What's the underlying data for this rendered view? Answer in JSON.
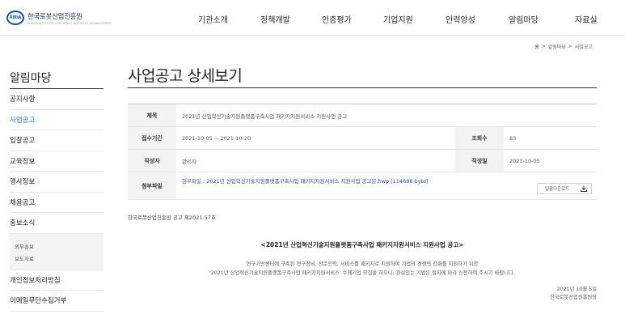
{
  "header": {
    "logo_mark": "KIRIA",
    "logo_name": "한국로봇산업진흥원",
    "logo_sub": "KOREA INSTITUTE FOR ROBOT INDUSTRY ADVANCEMENT",
    "nav": [
      "기관소개",
      "정책개발",
      "인증평가",
      "기업지원",
      "인력양성",
      "알림마당",
      "자료실"
    ]
  },
  "breadcrumb": {
    "home": "홈",
    "sep": ">",
    "level1": "알림마당",
    "level2": "사업공고"
  },
  "sidebar": {
    "title": "알림마당",
    "items": [
      {
        "label": "공지사항"
      },
      {
        "label": "사업공고",
        "active": true
      },
      {
        "label": "입찰공고"
      },
      {
        "label": "교육정보"
      },
      {
        "label": "행사정보"
      },
      {
        "label": "채용공고"
      },
      {
        "label": "홍보소식"
      }
    ],
    "sub_items": [
      "외부홍보",
      "보도자료"
    ],
    "bottom_items": [
      "개인정보처리방침",
      "이메일무단수집거부"
    ]
  },
  "main": {
    "page_title": "사업공고 상세보기",
    "board": {
      "subject_label": "제목",
      "subject": "2021년 산업혁신기술지원플랫폼구축사업 패키지지원서비스 지원사업 공고",
      "period_label": "접수기간",
      "period": "2021-10-05 ~ 2021-10-20",
      "views_label": "조회수",
      "views": "83",
      "author_label": "작성자",
      "author": "관리자",
      "date_label": "작성일",
      "date": "2021-10-05",
      "attach_label": "첨부파일",
      "attach_file": "첨부파일 : 2021년 산업혁신기술지원플랫폼구축사업 패키지지원서비스 지원사업 공고문.hwp [114688 byte]",
      "download_all": "일괄다운로드"
    },
    "notice_no": "한국로봇산업진흥원 공고 제2021-57호",
    "content_title": "<2021년 산업혁신기술지원플랫폼구축사업 패키지지원서비스 지원사업 공고>",
    "content_line1": "연구기반센터에 구축된 연구장비, 전문인력, 서비스를 패키지로 지원하여 기업의 경쟁력 강화를 지원하기 위한",
    "content_line2": "'2021년 산업혁신기술지원플랫폼구축사업 패키지지원서비스' 수혜기업 모집을 하오니, 관심있는 기업은 절차에 따라 신청하여 주시기 바랍니다.",
    "sign_date": "2021년 10월 5일",
    "sign_org": "한국로봇산업진흥원장"
  }
}
